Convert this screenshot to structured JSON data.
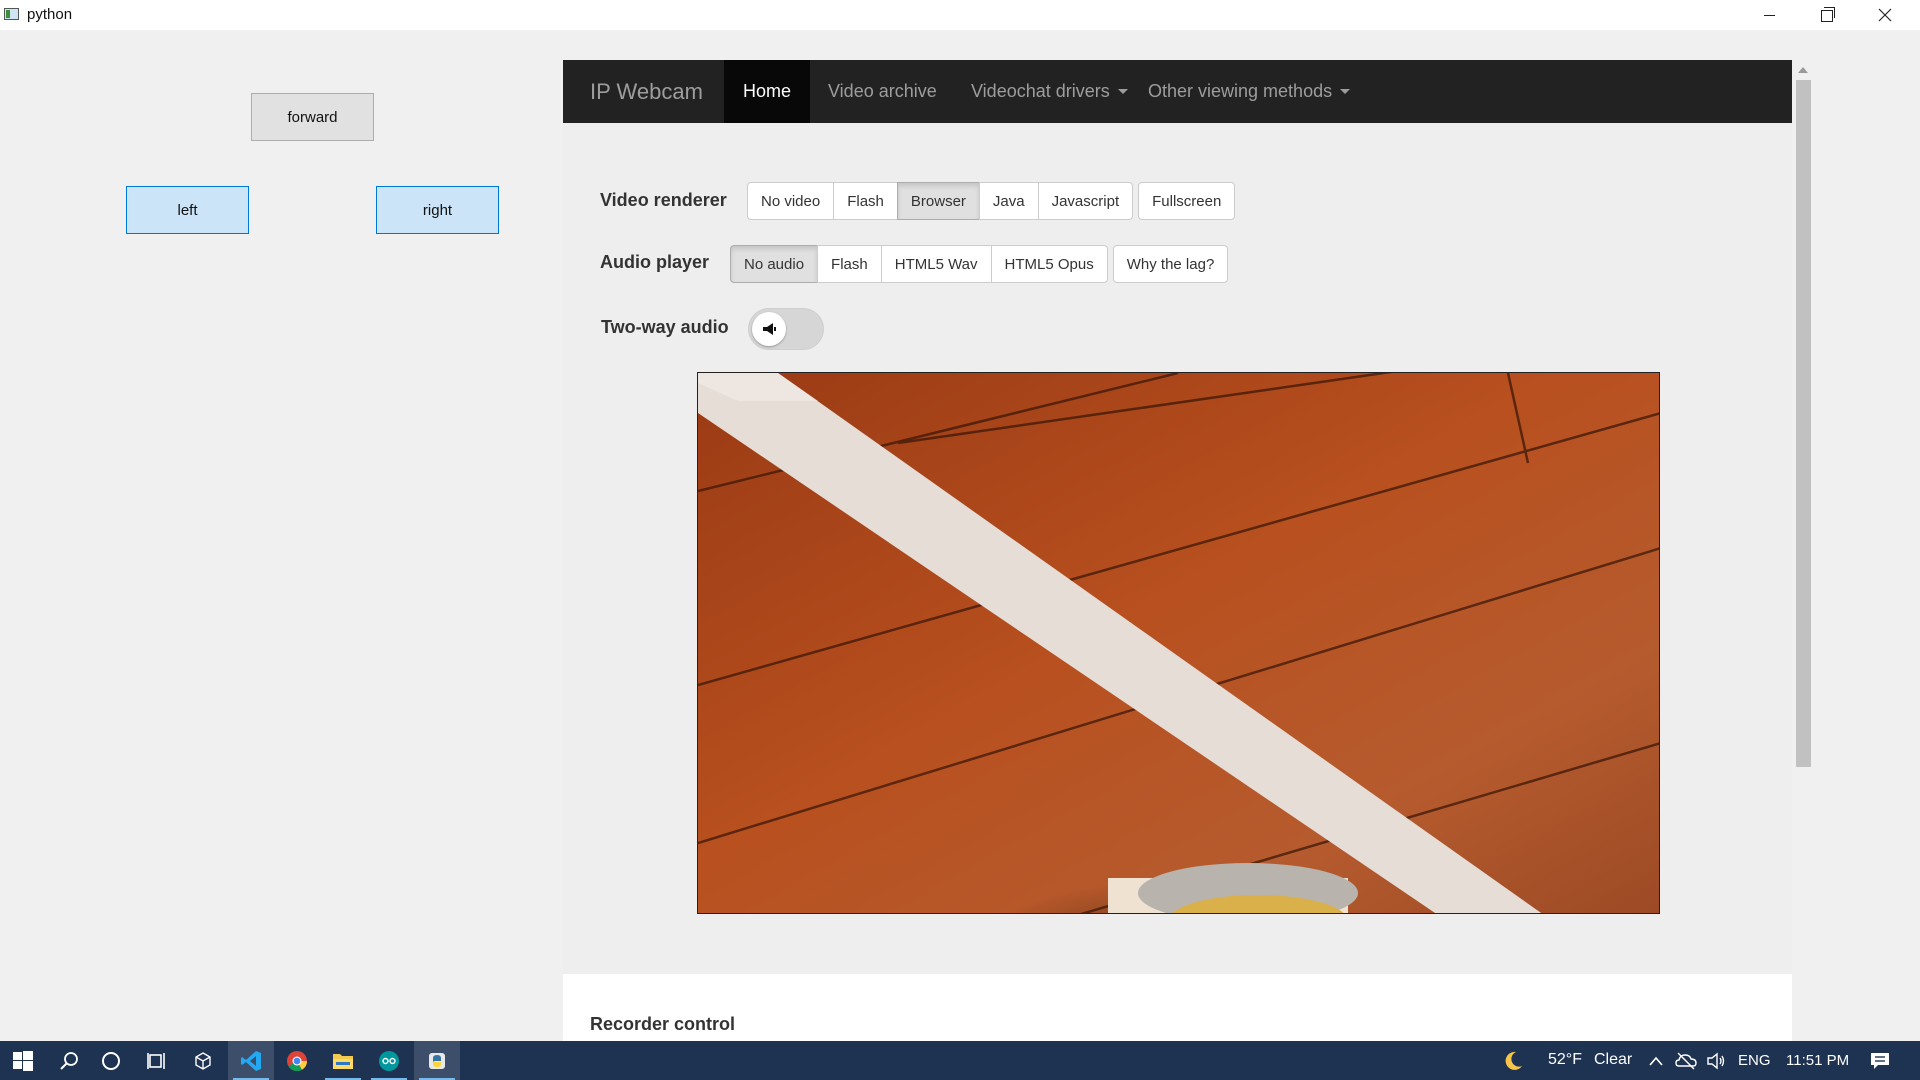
{
  "window": {
    "title": "python"
  },
  "controls": {
    "forward": "forward",
    "left": "left",
    "right": "right"
  },
  "web": {
    "brand": "IP Webcam",
    "nav": [
      {
        "label": "Home",
        "active": true
      },
      {
        "label": "Video archive"
      },
      {
        "label": "Videochat drivers",
        "dropdown": true
      },
      {
        "label": "Other viewing methods",
        "dropdown": true
      }
    ],
    "video_renderer": {
      "label": "Video renderer",
      "options": [
        "No video",
        "Flash",
        "Browser",
        "Java",
        "Javascript"
      ],
      "selected": "Browser",
      "extra": "Fullscreen"
    },
    "audio_player": {
      "label": "Audio player",
      "options": [
        "No audio",
        "Flash",
        "HTML5 Wav",
        "HTML5 Opus"
      ],
      "selected": "No audio",
      "extra": "Why the lag?"
    },
    "two_way_audio": {
      "label": "Two-way audio",
      "icon": "megaphone-icon"
    },
    "recorder": {
      "title": "Recorder control"
    }
  },
  "taskbar": {
    "apps": [
      "windows-start-icon",
      "search-icon",
      "cortana-icon",
      "task-view-icon",
      "3d-viewer-icon",
      "vscode-icon",
      "chrome-icon",
      "file-explorer-icon",
      "arduino-icon",
      "python-icon"
    ],
    "weather": {
      "temp": "52°F",
      "condition": "Clear"
    },
    "language": "ENG",
    "time": "11:51 PM"
  }
}
